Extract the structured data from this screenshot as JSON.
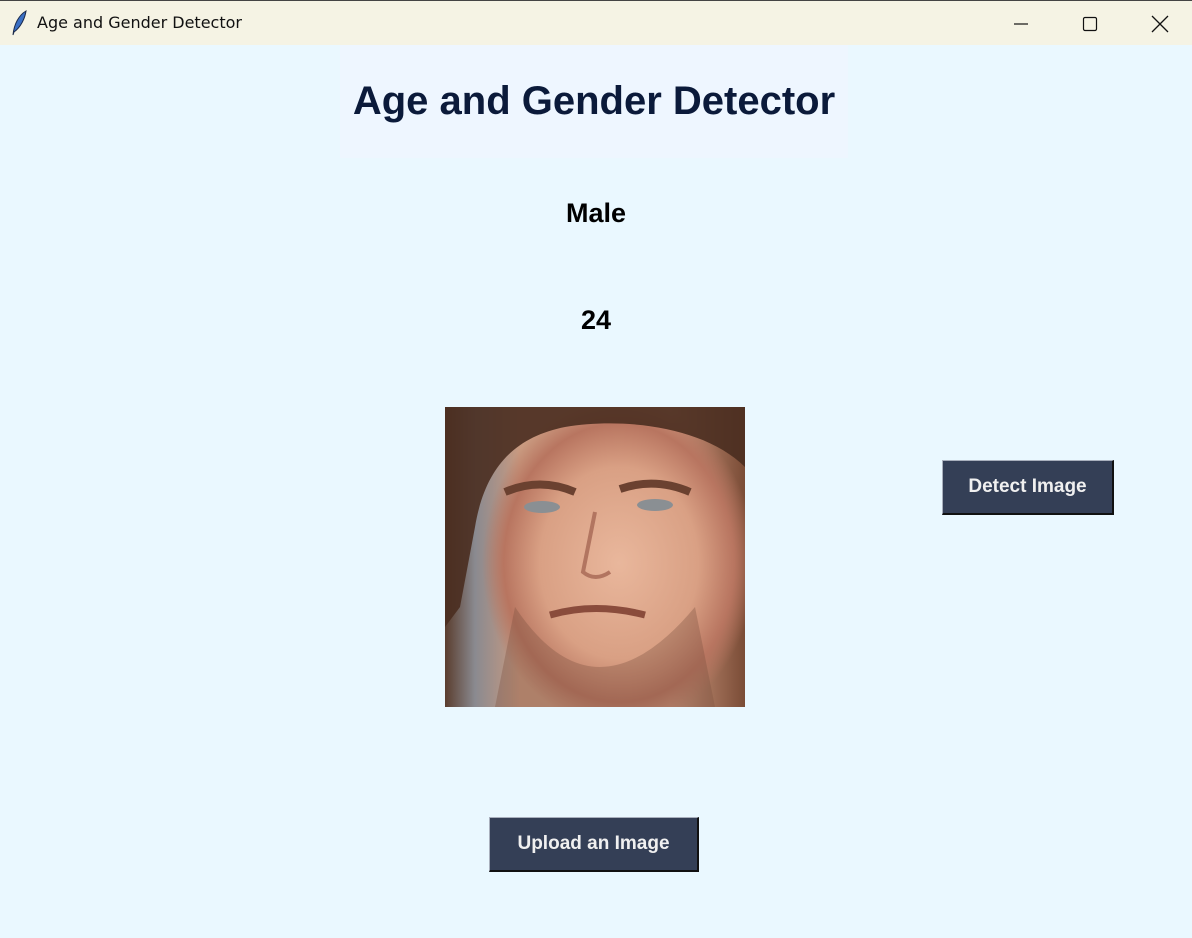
{
  "window": {
    "title": "Age and Gender Detector",
    "icon": "feather-icon"
  },
  "main": {
    "heading": "Age and Gender Detector",
    "gender_result": "Male",
    "age_result": "24",
    "detect_button": "Detect Image",
    "upload_button": "Upload an Image"
  },
  "colors": {
    "background": "#eaf8ff",
    "button": "#343f56",
    "heading": "#0b1a3a"
  }
}
